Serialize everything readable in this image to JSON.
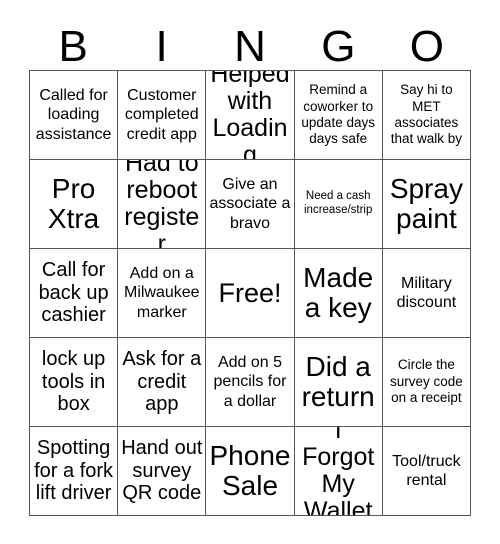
{
  "card": {
    "header_letters": [
      "B",
      "I",
      "N",
      "G",
      "O"
    ],
    "grid_columns": 5,
    "grid_rows": 5,
    "border_color": "#555555",
    "text_color": "#000000",
    "background_color": "#ffffff",
    "cells": [
      {
        "text": "Called for loading assistance",
        "size": "m",
        "free": false
      },
      {
        "text": "Customer completed credit app",
        "size": "m",
        "free": false
      },
      {
        "text": "Helped with Loading",
        "size": "xl",
        "free": false
      },
      {
        "text": "Remind a coworker to update days days safe",
        "size": "s",
        "free": false
      },
      {
        "text": "Say hi to MET associates that walk by",
        "size": "s",
        "free": false
      },
      {
        "text": "Pro Xtra",
        "size": "xxl",
        "free": false
      },
      {
        "text": "Had to reboot register",
        "size": "xl",
        "free": false
      },
      {
        "text": "Give an associate a bravo",
        "size": "m",
        "free": false
      },
      {
        "text": "Need a cash increase/strip",
        "size": "xs",
        "free": false
      },
      {
        "text": "Spray paint",
        "size": "xxl",
        "free": false
      },
      {
        "text": "Call for back up cashier",
        "size": "l",
        "free": false
      },
      {
        "text": "Add on a Milwaukee marker",
        "size": "m",
        "free": false
      },
      {
        "text": "Free!",
        "size": "xxl",
        "free": true
      },
      {
        "text": "Made a key",
        "size": "xxl",
        "free": false
      },
      {
        "text": "Military discount",
        "size": "m",
        "free": false
      },
      {
        "text": "lock up tools in box",
        "size": "l",
        "free": false
      },
      {
        "text": "Ask for a credit app",
        "size": "l",
        "free": false
      },
      {
        "text": "Add on 5 pencils for a dollar",
        "size": "m",
        "free": false
      },
      {
        "text": "Did a return",
        "size": "xxl",
        "free": false
      },
      {
        "text": "Circle the survey code on a receipt",
        "size": "s",
        "free": false
      },
      {
        "text": "Spotting for a fork lift driver",
        "size": "l",
        "free": false
      },
      {
        "text": "Hand out survey QR code",
        "size": "l",
        "free": false
      },
      {
        "text": "Phone Sale",
        "size": "xxl",
        "free": false
      },
      {
        "text": "I Forgot My Wallet",
        "size": "xl",
        "free": false
      },
      {
        "text": "Tool/truck rental",
        "size": "m",
        "free": false
      }
    ]
  }
}
